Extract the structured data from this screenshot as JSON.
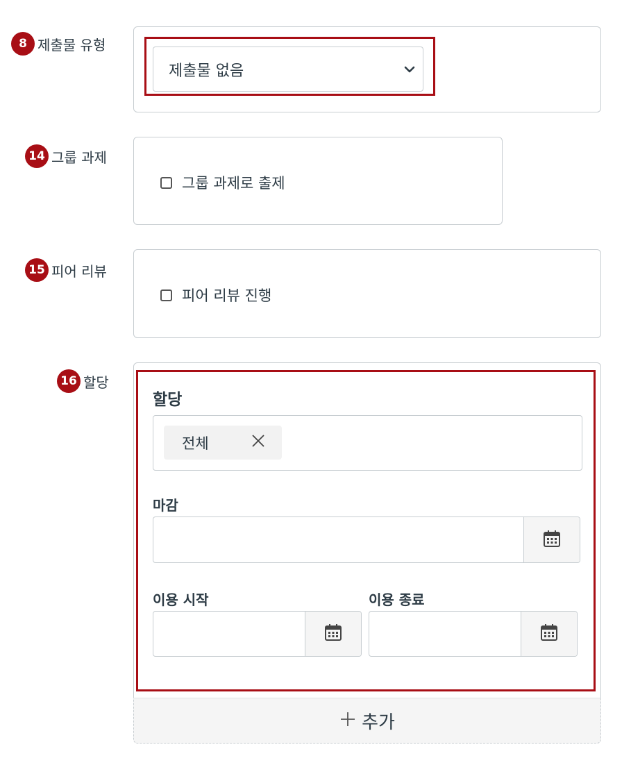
{
  "submission_type": {
    "badge": "8",
    "label": "제출물 유형",
    "selected": "제출물 없음",
    "icons": {
      "dropdown": "chevron-down-icon"
    }
  },
  "group_assignment": {
    "badge": "14",
    "label": "그룹 과제",
    "checkbox_label": "그룹 과제로 출제",
    "checked": false
  },
  "peer_review": {
    "badge": "15",
    "label": "피어 리뷰",
    "checkbox_label": "피어 리뷰 진행",
    "checked": false
  },
  "assign": {
    "badge": "16",
    "label": "할당",
    "title": "할당",
    "assign_tag": "전체",
    "due_label": "마감",
    "due_value": "",
    "available_from_label": "이용 시작",
    "available_from_value": "",
    "until_label": "이용 종료",
    "until_value": "",
    "add_label": "추가",
    "icons": {
      "remove": "close-icon",
      "calendar": "calendar-icon",
      "add": "plus-icon"
    }
  },
  "colors": {
    "accent": "#a80e15",
    "border": "#c7cdd1",
    "text": "#2d3b45",
    "button_bg": "#f5f5f5"
  }
}
